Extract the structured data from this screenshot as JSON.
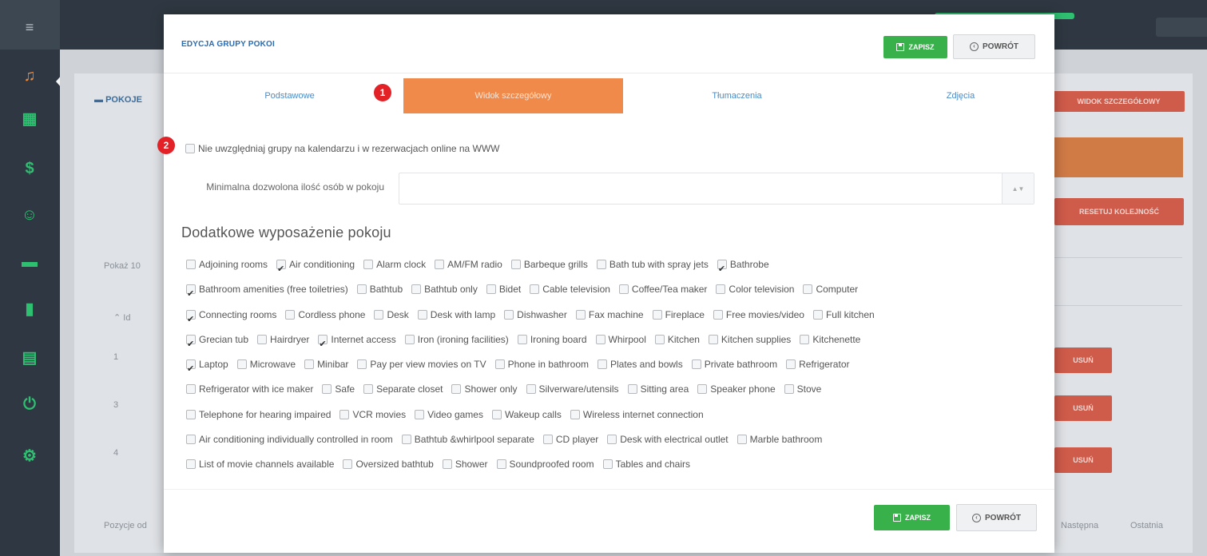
{
  "colors": {
    "accent_orange": "#f08a4b",
    "save_green": "#38b14a",
    "title_blue": "#2b6cb0",
    "badge_red": "#e32227",
    "sidebar": "#2f3842"
  },
  "sidebar": {
    "icons": [
      "menu-icon",
      "bell-icon",
      "calendar-icon",
      "dollar-icon",
      "users-icon",
      "bed-icon",
      "bar-chart-icon",
      "document-icon",
      "power-icon",
      "gears-icon"
    ]
  },
  "background": {
    "title": "POKOJE",
    "detail_view_btn": "WIDOK SZCZEGÓŁOWY",
    "reset_order_btn": "RESETUJ KOLEJNOŚĆ",
    "show_label": "Pokaż",
    "show_count": "10",
    "id_header": "Id",
    "ids": [
      "1",
      "3",
      "4"
    ],
    "delete_label": "USUŃ",
    "positions_text": "Pozycje od",
    "next_label": "Następna",
    "last_label": "Ostatnia"
  },
  "modal": {
    "title": "EDYCJA GRUPY POKOI",
    "save_label": "ZAPISZ",
    "back_label": "POWRÓT",
    "tabs": [
      {
        "label": "Podstawowe"
      },
      {
        "label": "Widok szczegółowy"
      },
      {
        "label": "Tłumaczenia"
      },
      {
        "label": "Zdjęcia"
      }
    ],
    "badge1": "1",
    "badge2": "2",
    "exclude_label": "Nie uwzględniaj grupy na kalendarzu i w rezerwacjach online na WWW",
    "exclude_checked": false,
    "min_persons_label": "Minimalna dozwolona ilość osób w pokoju",
    "min_persons_value": "",
    "section_title": "Dodatkowe wyposażenie pokoju",
    "amenities": [
      {
        "label": "Adjoining rooms",
        "checked": false
      },
      {
        "label": "Air conditioning",
        "checked": true
      },
      {
        "label": "Alarm clock",
        "checked": false
      },
      {
        "label": "AM/FM radio",
        "checked": false
      },
      {
        "label": "Barbeque grills",
        "checked": false
      },
      {
        "label": "Bath tub with spray jets",
        "checked": false
      },
      {
        "label": "Bathrobe",
        "checked": true
      },
      {
        "label": "Bathroom amenities (free toiletries)",
        "checked": true
      },
      {
        "label": "Bathtub",
        "checked": false
      },
      {
        "label": "Bathtub only",
        "checked": false
      },
      {
        "label": "Bidet",
        "checked": false
      },
      {
        "label": "Cable television",
        "checked": false
      },
      {
        "label": "Coffee/Tea maker",
        "checked": false
      },
      {
        "label": "Color television",
        "checked": false
      },
      {
        "label": "Computer",
        "checked": false
      },
      {
        "label": "Connecting rooms",
        "checked": true
      },
      {
        "label": "Cordless phone",
        "checked": false
      },
      {
        "label": "Desk",
        "checked": false
      },
      {
        "label": "Desk with lamp",
        "checked": false
      },
      {
        "label": "Dishwasher",
        "checked": false
      },
      {
        "label": "Fax machine",
        "checked": false
      },
      {
        "label": "Fireplace",
        "checked": false
      },
      {
        "label": "Free movies/video",
        "checked": false
      },
      {
        "label": "Full kitchen",
        "checked": false
      },
      {
        "label": "Grecian tub",
        "checked": true
      },
      {
        "label": "Hairdryer",
        "checked": false
      },
      {
        "label": "Internet access",
        "checked": true
      },
      {
        "label": "Iron (ironing facilities)",
        "checked": false
      },
      {
        "label": "Ironing board",
        "checked": false
      },
      {
        "label": "Whirpool",
        "checked": false
      },
      {
        "label": "Kitchen",
        "checked": false
      },
      {
        "label": "Kitchen supplies",
        "checked": false
      },
      {
        "label": "Kitchenette",
        "checked": false
      },
      {
        "label": "Laptop",
        "checked": true
      },
      {
        "label": "Microwave",
        "checked": false
      },
      {
        "label": "Minibar",
        "checked": false
      },
      {
        "label": "Pay per view movies on TV",
        "checked": false
      },
      {
        "label": "Phone in bathroom",
        "checked": false
      },
      {
        "label": "Plates and bowls",
        "checked": false
      },
      {
        "label": "Private bathroom",
        "checked": false
      },
      {
        "label": "Refrigerator",
        "checked": false
      },
      {
        "label": "Refrigerator with ice maker",
        "checked": false
      },
      {
        "label": "Safe",
        "checked": false
      },
      {
        "label": "Separate closet",
        "checked": false
      },
      {
        "label": "Shower only",
        "checked": false
      },
      {
        "label": "Silverware/utensils",
        "checked": false
      },
      {
        "label": "Sitting area",
        "checked": false
      },
      {
        "label": "Speaker phone",
        "checked": false
      },
      {
        "label": "Stove",
        "checked": false
      },
      {
        "label": "Telephone for hearing impaired",
        "checked": false
      },
      {
        "label": "VCR movies",
        "checked": false
      },
      {
        "label": "Video games",
        "checked": false
      },
      {
        "label": "Wakeup calls",
        "checked": false
      },
      {
        "label": "Wireless internet connection",
        "checked": false
      },
      {
        "label": "Air conditioning individually controlled in room",
        "checked": false
      },
      {
        "label": "Bathtub &whirlpool separate",
        "checked": false
      },
      {
        "label": "CD player",
        "checked": false
      },
      {
        "label": "Desk with electrical outlet",
        "checked": false
      },
      {
        "label": "Marble bathroom",
        "checked": false
      },
      {
        "label": "List of movie channels available",
        "checked": false
      },
      {
        "label": "Oversized bathtub",
        "checked": false
      },
      {
        "label": "Shower",
        "checked": false
      },
      {
        "label": "Soundproofed room",
        "checked": false
      },
      {
        "label": "Tables and chairs",
        "checked": false
      }
    ]
  }
}
